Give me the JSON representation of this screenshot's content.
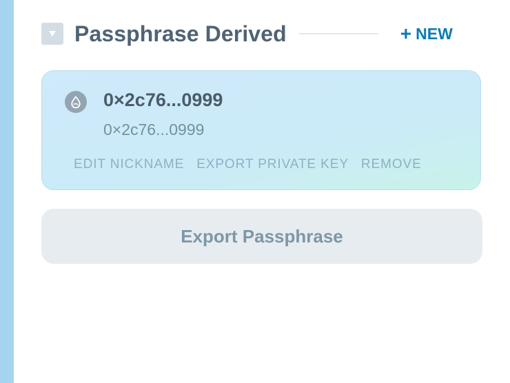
{
  "section": {
    "title": "Passphrase Derived",
    "new_plus": "+",
    "new_label": "NEW"
  },
  "account": {
    "name": "0×2c76...0999",
    "address": "0×2c76...0999",
    "icon": "sui-droplet-icon",
    "actions": {
      "edit_nickname": "EDIT NICKNAME",
      "export_private_key": "EXPORT PRIVATE KEY",
      "remove": "REMOVE"
    }
  },
  "export_button": {
    "label": "Export Passphrase"
  },
  "colors": {
    "accent": "#0b7bb4",
    "title": "#4f6373",
    "side_strip": "#a6d3ef",
    "card_bg": "#cdebf9",
    "button_bg": "#e7ecf0"
  }
}
